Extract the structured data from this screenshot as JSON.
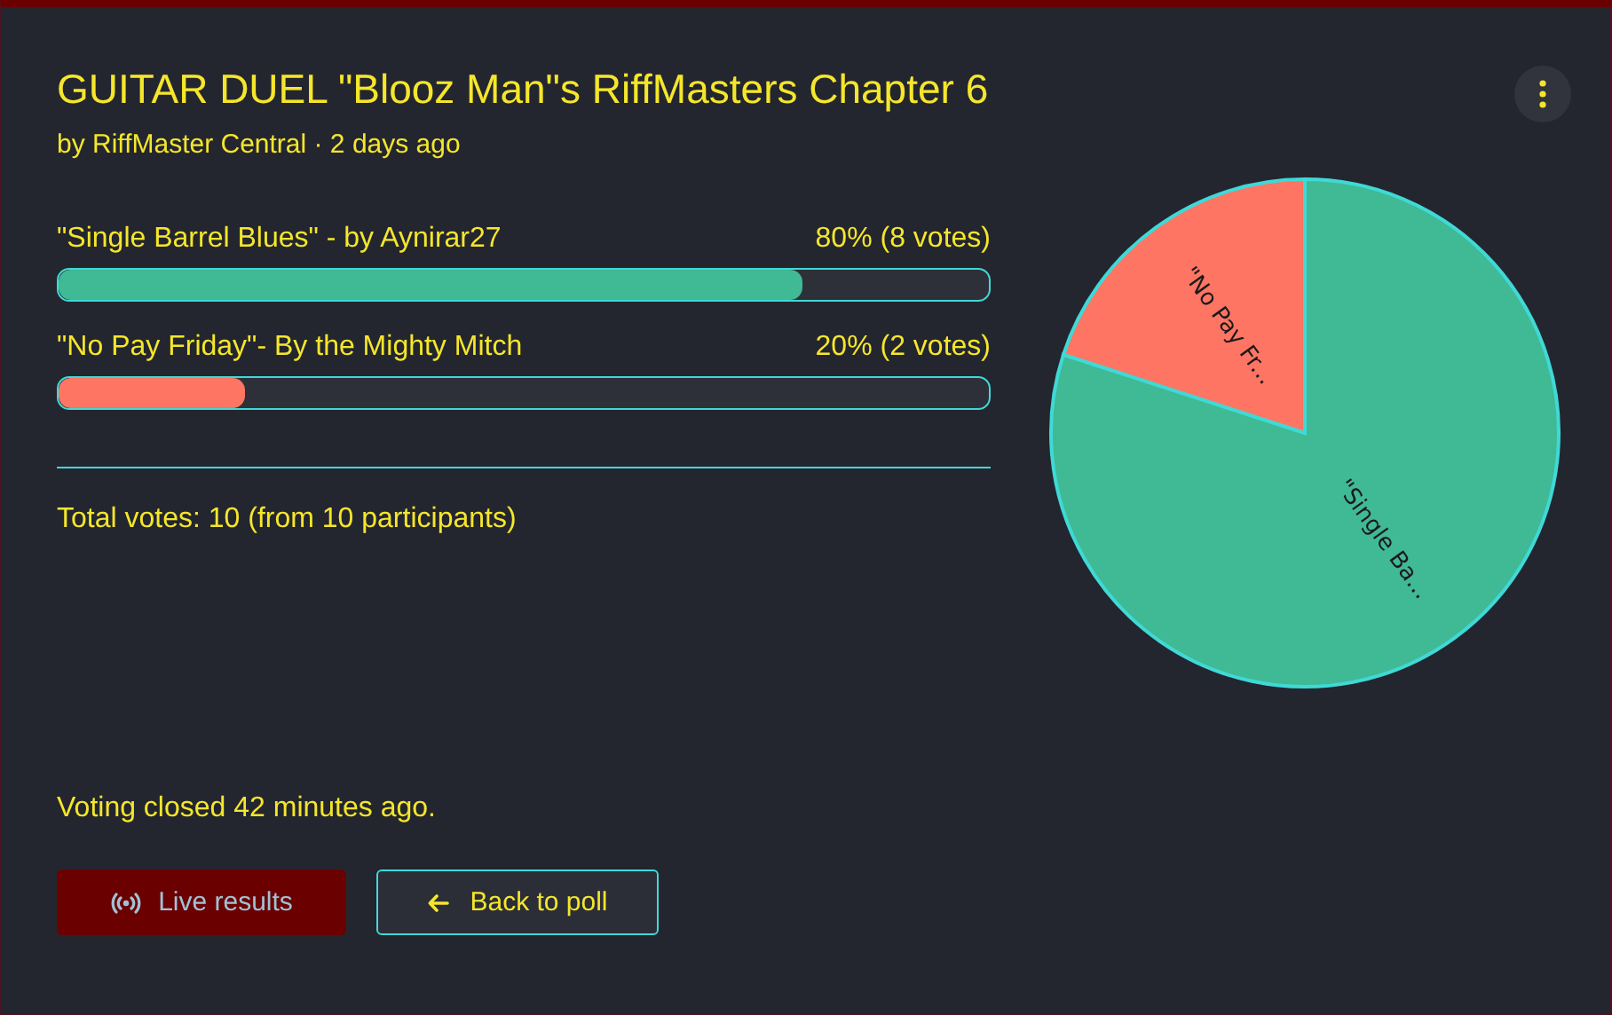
{
  "poll": {
    "title": "GUITAR DUEL \"Blooz Man\"s RiffMasters Chapter 6",
    "byline": "by RiffMaster Central · 2 days ago"
  },
  "options": [
    {
      "label": "\"Single Barrel Blues\" - by Aynirar27",
      "result": "80% (8 votes)",
      "level": 0.8,
      "color": "#40b995"
    },
    {
      "label": "\"No Pay Friday\"- By the Mighty Mitch",
      "result": "20% (2 votes)",
      "level": 0.2,
      "color": "#ff7563"
    }
  ],
  "total": "Total votes: 10 (from 10 participants)",
  "status": "Voting closed 42 minutes ago.",
  "buttons": [
    {
      "kind": "live",
      "label": "Live results"
    },
    {
      "kind": "back",
      "label": "Back to poll"
    }
  ],
  "chart_data": {
    "type": "pie",
    "categories": [
      "\"Single Ba...",
      "\"No Pay Fr..."
    ],
    "values": [
      80,
      20
    ],
    "colors": [
      "#40b995",
      "#ff7563"
    ]
  }
}
